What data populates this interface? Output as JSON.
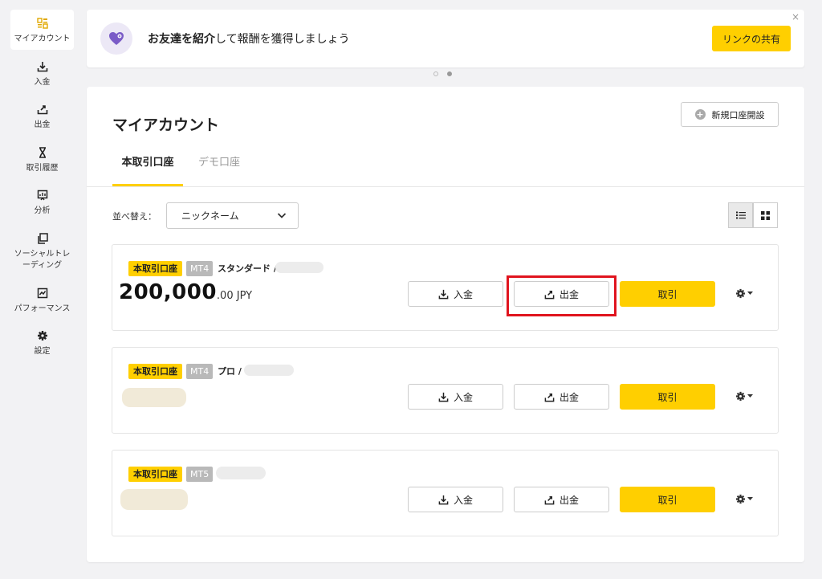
{
  "sidebar": {
    "items": [
      {
        "label": "マイアカウント",
        "icon": "dashboard-icon",
        "active": true
      },
      {
        "label": "入金",
        "icon": "download-icon"
      },
      {
        "label": "出金",
        "icon": "upload-icon"
      },
      {
        "label": "取引履歴",
        "icon": "hourglass-icon"
      },
      {
        "label": "分析",
        "icon": "chart-board-icon"
      },
      {
        "label": "ソーシャルトレーディング",
        "icon": "copy-icon"
      },
      {
        "label": "パフォーマンス",
        "icon": "performance-icon"
      },
      {
        "label": "設定",
        "icon": "gear-icon"
      }
    ]
  },
  "banner": {
    "message_bold1": "お友達を紹介",
    "message_rest": "して報酬を獲得しましょう",
    "share_label": "リンクの共有",
    "close_symbol": "×"
  },
  "main": {
    "title": "マイアカウント",
    "new_account_label": "新規口座開設",
    "tabs": [
      {
        "label": "本取引口座",
        "active": true
      },
      {
        "label": "デモ口座",
        "active": false
      }
    ],
    "sort": {
      "label": "並べ替え：",
      "value": "ニックネーム"
    }
  },
  "accounts": [
    {
      "type_badge": "本取引口座",
      "platform": "MT4",
      "name": "スタンダード /",
      "balance_main": "200,000",
      "balance_sub": ".00 JPY",
      "deposit_label": "入金",
      "withdraw_label": "出金",
      "trade_label": "取引"
    },
    {
      "type_badge": "本取引口座",
      "platform": "MT4",
      "name": "プロ /",
      "balance_main": "",
      "balance_sub": "",
      "deposit_label": "入金",
      "withdraw_label": "出金",
      "trade_label": "取引"
    },
    {
      "type_badge": "本取引口座",
      "platform": "MT5",
      "name": "",
      "balance_main": "",
      "balance_sub": "",
      "deposit_label": "入金",
      "withdraw_label": "出金",
      "trade_label": "取引"
    }
  ],
  "colors": {
    "accent": "#ffcf00",
    "highlight": "#e0141e",
    "badge_gray": "#b9b9b9"
  }
}
